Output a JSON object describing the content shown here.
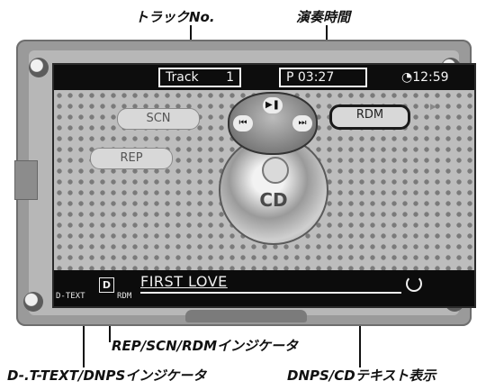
{
  "callouts": {
    "track_no": "トラックNo.",
    "play_time": "演奏時間",
    "rep_scn_rdm": "REP/SCN/RDMインジケータ",
    "dtext_dnps": "D-.T-TEXT/DNPSインジケータ",
    "dnps_cd_text": "DNPS/CDテキスト表示"
  },
  "display": {
    "track_label": "Track",
    "track_number": "1",
    "play_time": "P 03:27",
    "clock": "12:59",
    "scan": "SCN",
    "repeat": "REP",
    "random": "RDM",
    "disc_label": "CD",
    "text_badge": "D",
    "title": "FIRST LOVE",
    "dtext_indicator": "D-TEXT",
    "rdm_indicator": "RDM"
  },
  "icons": [
    "clock-icon",
    "play-pause-icon",
    "previous-track-icon",
    "next-track-icon",
    "power-icon"
  ]
}
